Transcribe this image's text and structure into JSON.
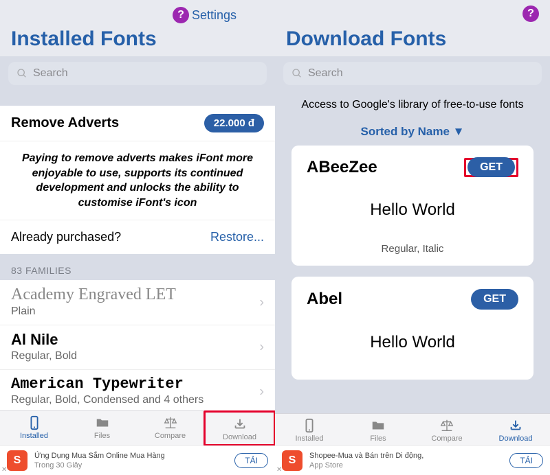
{
  "left": {
    "settings_label": "Settings",
    "title": "Installed Fonts",
    "search_placeholder": "Search",
    "remove_adverts": {
      "title": "Remove Adverts",
      "price": "22.000 đ",
      "description": "Paying to remove adverts makes iFont more enjoyable to use, supports its continued development and unlocks the ability to customise iFont's icon",
      "already": "Already purchased?",
      "restore": "Restore..."
    },
    "section_title": "83 FAMILIES",
    "fonts": [
      {
        "name": "Academy Engraved LET",
        "styles": "Plain",
        "css": "f-academy"
      },
      {
        "name": "Al Nile",
        "styles": "Regular, Bold",
        "css": "f-alnile"
      },
      {
        "name": "American Typewriter",
        "styles": "Regular, Bold, Condensed and 4 others",
        "css": "f-typewriter"
      }
    ],
    "tabs": {
      "installed": "Installed",
      "files": "Files",
      "compare": "Compare",
      "download": "Download"
    },
    "ad": {
      "line1": "Ứng Dụng Mua Sắm Online Mua Hàng",
      "line2": "Trong 30 Giây",
      "button": "TẢI"
    }
  },
  "right": {
    "title": "Download Fonts",
    "search_placeholder": "Search",
    "info": "Access to Google's library of free-to-use fonts",
    "sort_label": "Sorted by Name ▼",
    "cards": [
      {
        "name": "ABeeZee",
        "get": "GET",
        "preview": "Hello World",
        "styles": "Regular, Italic",
        "highlight": true
      },
      {
        "name": "Abel",
        "get": "GET",
        "preview": "Hello World",
        "styles": "",
        "highlight": false
      }
    ],
    "tabs": {
      "installed": "Installed",
      "files": "Files",
      "compare": "Compare",
      "download": "Download"
    },
    "ad": {
      "line1": "Shopee-Mua và Bán trên Di động,",
      "line2": "App Store",
      "button": "TẢI"
    }
  }
}
